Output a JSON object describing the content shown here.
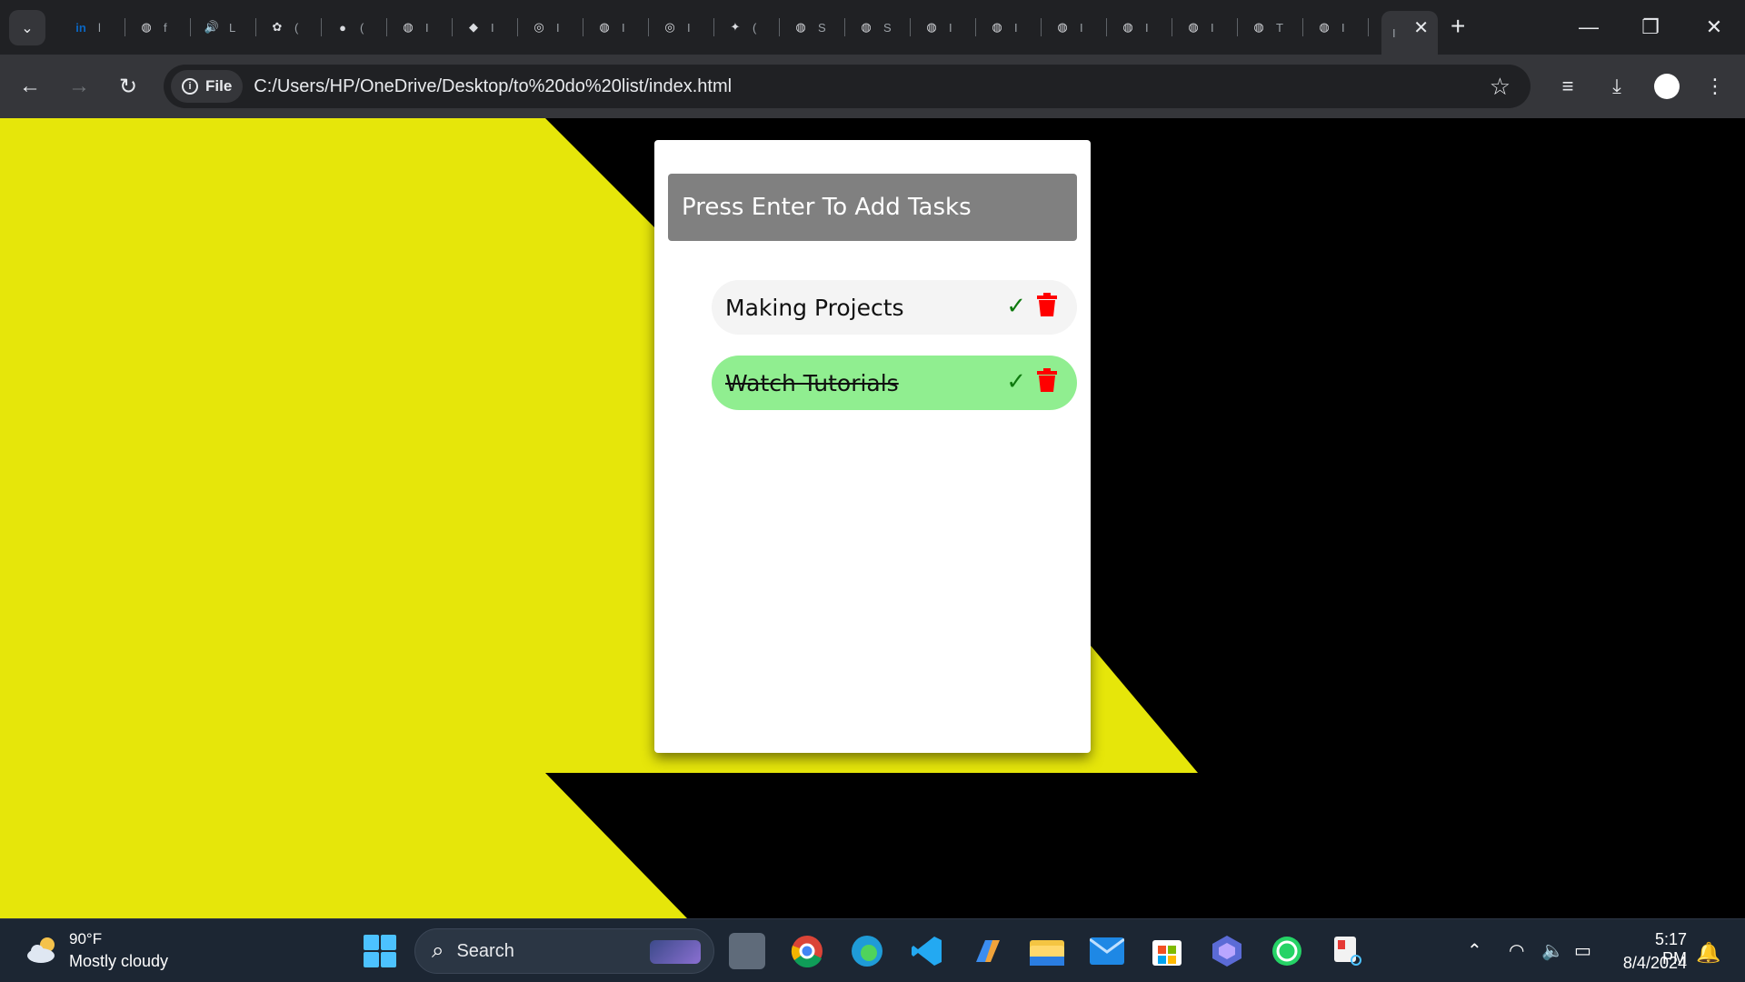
{
  "browser": {
    "tabs": [
      {
        "icon": "linkedin-icon",
        "label": "l",
        "color": "#0a66c2",
        "glyph": "in"
      },
      {
        "icon": "globe-icon",
        "label": "f",
        "glyph": "◍"
      },
      {
        "icon": "speaker-icon",
        "label": "L",
        "glyph": "🔊"
      },
      {
        "icon": "openai-icon",
        "label": "(",
        "glyph": "✿"
      },
      {
        "icon": "github-icon",
        "label": "(",
        "glyph": "●"
      },
      {
        "icon": "globe-icon",
        "label": "I",
        "glyph": "◍"
      },
      {
        "icon": "cube-icon",
        "label": "I",
        "glyph": "◆"
      },
      {
        "icon": "chrome-icon",
        "label": "I",
        "glyph": "◎"
      },
      {
        "icon": "globe-icon",
        "label": "I",
        "glyph": "◍"
      },
      {
        "icon": "chrome-icon",
        "label": "I",
        "glyph": "◎"
      },
      {
        "icon": "gemini-icon",
        "label": "(",
        "glyph": "✦"
      },
      {
        "icon": "globe-icon",
        "label": "S",
        "glyph": "◍"
      },
      {
        "icon": "globe-icon",
        "label": "S",
        "glyph": "◍"
      },
      {
        "icon": "globe-icon",
        "label": "I",
        "glyph": "◍"
      },
      {
        "icon": "globe-icon",
        "label": "I",
        "glyph": "◍"
      },
      {
        "icon": "globe-icon",
        "label": "I",
        "glyph": "◍"
      },
      {
        "icon": "globe-icon",
        "label": "I",
        "glyph": "◍"
      },
      {
        "icon": "globe-icon",
        "label": "I",
        "glyph": "◍"
      },
      {
        "icon": "globe-icon",
        "label": "T",
        "glyph": "◍"
      },
      {
        "icon": "globe-icon",
        "label": "I",
        "glyph": "◍"
      }
    ],
    "active_tab_label": "I",
    "security_chip": "File",
    "url": "C:/Users/HP/OneDrive/Desktop/to%20do%20list/index.html"
  },
  "app": {
    "input_placeholder": "Press Enter To Add Tasks",
    "tasks": [
      {
        "text": "Making Projects",
        "done": false
      },
      {
        "text": "Watch Tutorials",
        "done": true
      }
    ],
    "colors": {
      "background_yellow": "#e6e60a",
      "background_black": "#000000",
      "input_bg": "#808080",
      "task_bg": "#f4f4f4",
      "done_bg": "#90ee90",
      "check": "#0f7a0f",
      "trash": "#ff0000"
    }
  },
  "taskbar": {
    "weather_temp": "90°F",
    "weather_desc": "Mostly cloudy",
    "search_label": "Search",
    "time": "5:17 PM",
    "date": "8/4/2024"
  }
}
